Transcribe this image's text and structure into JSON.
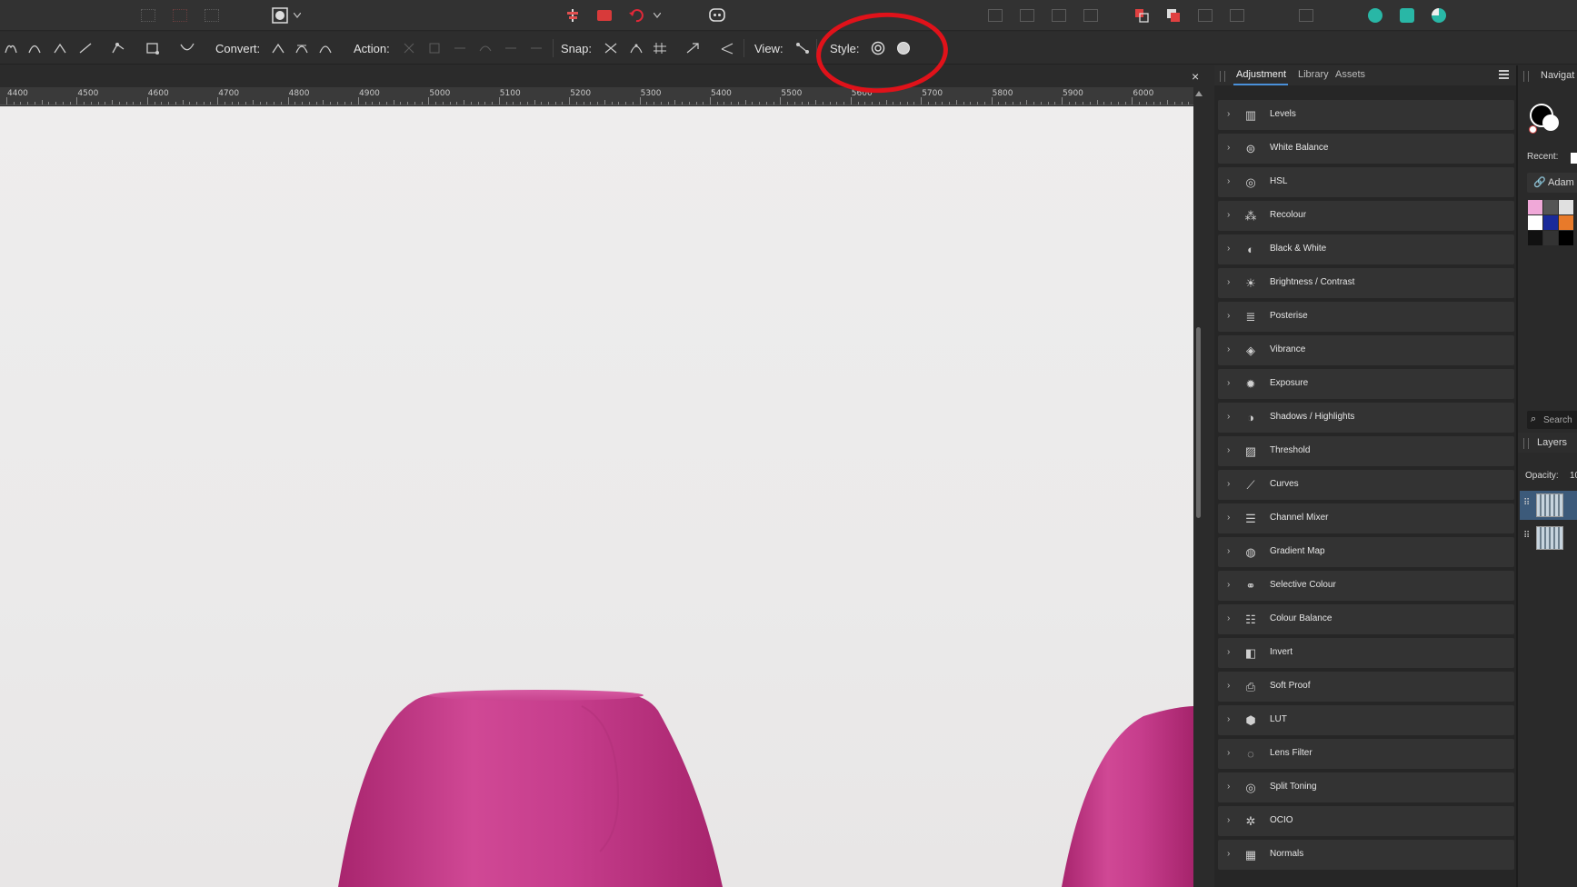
{
  "context_toolbar": {
    "convert_label": "Convert:",
    "action_label": "Action:",
    "snap_label": "Snap:",
    "view_label": "View:",
    "style_label": "Style:"
  },
  "ruler": {
    "labels": [
      "4400",
      "4500",
      "4600",
      "4700",
      "4800",
      "4900",
      "5000",
      "5100",
      "5200",
      "5300",
      "5400",
      "5500",
      "5600",
      "5700",
      "5800",
      "5900",
      "6000"
    ]
  },
  "document": {
    "close_glyph": "×"
  },
  "panel": {
    "tabs": [
      "Adjustment",
      "Library",
      "Assets"
    ],
    "active_tab": "Adjustment",
    "items": [
      {
        "label": "Levels",
        "icon": "levels-icon"
      },
      {
        "label": "White Balance",
        "icon": "white-balance-icon"
      },
      {
        "label": "HSL",
        "icon": "hsl-icon"
      },
      {
        "label": "Recolour",
        "icon": "recolour-icon"
      },
      {
        "label": "Black & White",
        "icon": "black-white-icon"
      },
      {
        "label": "Brightness / Contrast",
        "icon": "brightness-icon"
      },
      {
        "label": "Posterise",
        "icon": "posterise-icon"
      },
      {
        "label": "Vibrance",
        "icon": "vibrance-icon"
      },
      {
        "label": "Exposure",
        "icon": "exposure-icon"
      },
      {
        "label": "Shadows / Highlights",
        "icon": "shadows-highlights-icon"
      },
      {
        "label": "Threshold",
        "icon": "threshold-icon"
      },
      {
        "label": "Curves",
        "icon": "curves-icon"
      },
      {
        "label": "Channel Mixer",
        "icon": "channel-mixer-icon"
      },
      {
        "label": "Gradient Map",
        "icon": "gradient-map-icon"
      },
      {
        "label": "Selective Colour",
        "icon": "selective-colour-icon"
      },
      {
        "label": "Colour Balance",
        "icon": "colour-balance-icon"
      },
      {
        "label": "Invert",
        "icon": "invert-icon"
      },
      {
        "label": "Soft Proof",
        "icon": "soft-proof-icon"
      },
      {
        "label": "LUT",
        "icon": "lut-icon"
      },
      {
        "label": "Lens Filter",
        "icon": "lens-filter-icon"
      },
      {
        "label": "Split Toning",
        "icon": "split-toning-icon"
      },
      {
        "label": "OCIO",
        "icon": "ocio-icon"
      },
      {
        "label": "Normals",
        "icon": "normals-icon"
      }
    ]
  },
  "side_panel": {
    "navigator_label": "Navigat",
    "recent_label": "Recent:",
    "palette_label": "Adam",
    "search_placeholder": "Search",
    "layers_label": "Layers",
    "opacity_label": "Opacity:",
    "opacity_value": "10",
    "swatches": [
      "#f0a8d8",
      "#555555",
      "#e0e0e0",
      "#ffffff",
      "#1a2a9a",
      "#e87a2a",
      "#111111",
      "#333333",
      "#000000"
    ]
  },
  "colors": {
    "accent": "#4a90d9",
    "annotation": "#e0121a",
    "product_pink": "#c93a8a"
  }
}
